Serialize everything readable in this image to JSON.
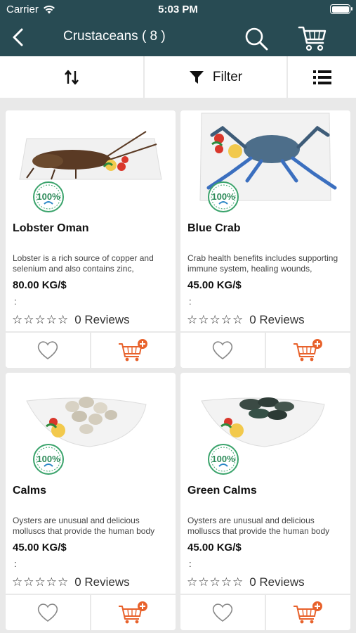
{
  "status_bar": {
    "carrier": "Carrier",
    "time": "5:03 PM"
  },
  "nav": {
    "title": "Crustaceans ( 8 )"
  },
  "toolbar": {
    "filter_label": "Filter"
  },
  "colors": {
    "header": "#284b53",
    "accent": "#e8622c",
    "badge": "#3aa36b"
  },
  "products": [
    {
      "name": "Lobster Oman",
      "description": "Lobster is a rich source of copper and selenium and also contains zinc,",
      "price": "80.00 KG/$",
      "colon": ":",
      "stars": "☆☆☆☆☆",
      "reviews": "0 Reviews",
      "badge": "100%",
      "image": "lobster"
    },
    {
      "name": "Blue Crab",
      "description": "Crab health benefits includes supporting immune system, healing wounds,",
      "price": "45.00 KG/$",
      "colon": ":",
      "stars": "☆☆☆☆☆",
      "reviews": "0 Reviews",
      "badge": "100%",
      "image": "crab"
    },
    {
      "name": "Calms",
      "description": "Oysters are unusual and delicious molluscs that provide the human body",
      "price": "45.00 KG/$",
      "colon": ":",
      "stars": "☆☆☆☆☆",
      "reviews": "0 Reviews",
      "badge": "100%",
      "image": "clams"
    },
    {
      "name": "Green Calms",
      "description": "Oysters are unusual and delicious molluscs that provide the human body",
      "price": "45.00 KG/$",
      "colon": ":",
      "stars": "☆☆☆☆☆",
      "reviews": "0 Reviews",
      "badge": "100%",
      "image": "mussels"
    }
  ]
}
